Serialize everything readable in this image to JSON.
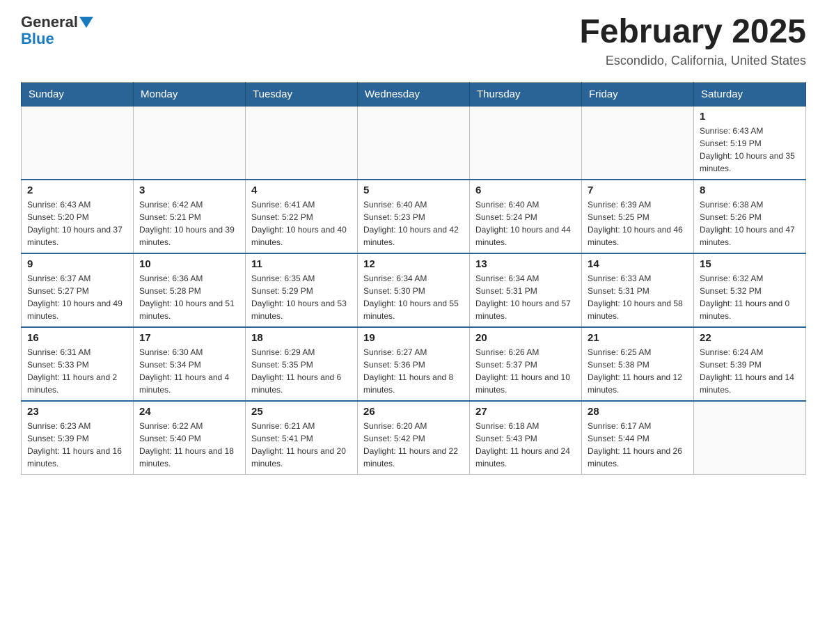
{
  "logo": {
    "line1": "General",
    "line2": "Blue"
  },
  "title": "February 2025",
  "location": "Escondido, California, United States",
  "days_of_week": [
    "Sunday",
    "Monday",
    "Tuesday",
    "Wednesday",
    "Thursday",
    "Friday",
    "Saturday"
  ],
  "weeks": [
    [
      {
        "day": "",
        "info": ""
      },
      {
        "day": "",
        "info": ""
      },
      {
        "day": "",
        "info": ""
      },
      {
        "day": "",
        "info": ""
      },
      {
        "day": "",
        "info": ""
      },
      {
        "day": "",
        "info": ""
      },
      {
        "day": "1",
        "info": "Sunrise: 6:43 AM\nSunset: 5:19 PM\nDaylight: 10 hours and 35 minutes."
      }
    ],
    [
      {
        "day": "2",
        "info": "Sunrise: 6:43 AM\nSunset: 5:20 PM\nDaylight: 10 hours and 37 minutes."
      },
      {
        "day": "3",
        "info": "Sunrise: 6:42 AM\nSunset: 5:21 PM\nDaylight: 10 hours and 39 minutes."
      },
      {
        "day": "4",
        "info": "Sunrise: 6:41 AM\nSunset: 5:22 PM\nDaylight: 10 hours and 40 minutes."
      },
      {
        "day": "5",
        "info": "Sunrise: 6:40 AM\nSunset: 5:23 PM\nDaylight: 10 hours and 42 minutes."
      },
      {
        "day": "6",
        "info": "Sunrise: 6:40 AM\nSunset: 5:24 PM\nDaylight: 10 hours and 44 minutes."
      },
      {
        "day": "7",
        "info": "Sunrise: 6:39 AM\nSunset: 5:25 PM\nDaylight: 10 hours and 46 minutes."
      },
      {
        "day": "8",
        "info": "Sunrise: 6:38 AM\nSunset: 5:26 PM\nDaylight: 10 hours and 47 minutes."
      }
    ],
    [
      {
        "day": "9",
        "info": "Sunrise: 6:37 AM\nSunset: 5:27 PM\nDaylight: 10 hours and 49 minutes."
      },
      {
        "day": "10",
        "info": "Sunrise: 6:36 AM\nSunset: 5:28 PM\nDaylight: 10 hours and 51 minutes."
      },
      {
        "day": "11",
        "info": "Sunrise: 6:35 AM\nSunset: 5:29 PM\nDaylight: 10 hours and 53 minutes."
      },
      {
        "day": "12",
        "info": "Sunrise: 6:34 AM\nSunset: 5:30 PM\nDaylight: 10 hours and 55 minutes."
      },
      {
        "day": "13",
        "info": "Sunrise: 6:34 AM\nSunset: 5:31 PM\nDaylight: 10 hours and 57 minutes."
      },
      {
        "day": "14",
        "info": "Sunrise: 6:33 AM\nSunset: 5:31 PM\nDaylight: 10 hours and 58 minutes."
      },
      {
        "day": "15",
        "info": "Sunrise: 6:32 AM\nSunset: 5:32 PM\nDaylight: 11 hours and 0 minutes."
      }
    ],
    [
      {
        "day": "16",
        "info": "Sunrise: 6:31 AM\nSunset: 5:33 PM\nDaylight: 11 hours and 2 minutes."
      },
      {
        "day": "17",
        "info": "Sunrise: 6:30 AM\nSunset: 5:34 PM\nDaylight: 11 hours and 4 minutes."
      },
      {
        "day": "18",
        "info": "Sunrise: 6:29 AM\nSunset: 5:35 PM\nDaylight: 11 hours and 6 minutes."
      },
      {
        "day": "19",
        "info": "Sunrise: 6:27 AM\nSunset: 5:36 PM\nDaylight: 11 hours and 8 minutes."
      },
      {
        "day": "20",
        "info": "Sunrise: 6:26 AM\nSunset: 5:37 PM\nDaylight: 11 hours and 10 minutes."
      },
      {
        "day": "21",
        "info": "Sunrise: 6:25 AM\nSunset: 5:38 PM\nDaylight: 11 hours and 12 minutes."
      },
      {
        "day": "22",
        "info": "Sunrise: 6:24 AM\nSunset: 5:39 PM\nDaylight: 11 hours and 14 minutes."
      }
    ],
    [
      {
        "day": "23",
        "info": "Sunrise: 6:23 AM\nSunset: 5:39 PM\nDaylight: 11 hours and 16 minutes."
      },
      {
        "day": "24",
        "info": "Sunrise: 6:22 AM\nSunset: 5:40 PM\nDaylight: 11 hours and 18 minutes."
      },
      {
        "day": "25",
        "info": "Sunrise: 6:21 AM\nSunset: 5:41 PM\nDaylight: 11 hours and 20 minutes."
      },
      {
        "day": "26",
        "info": "Sunrise: 6:20 AM\nSunset: 5:42 PM\nDaylight: 11 hours and 22 minutes."
      },
      {
        "day": "27",
        "info": "Sunrise: 6:18 AM\nSunset: 5:43 PM\nDaylight: 11 hours and 24 minutes."
      },
      {
        "day": "28",
        "info": "Sunrise: 6:17 AM\nSunset: 5:44 PM\nDaylight: 11 hours and 26 minutes."
      },
      {
        "day": "",
        "info": ""
      }
    ]
  ]
}
